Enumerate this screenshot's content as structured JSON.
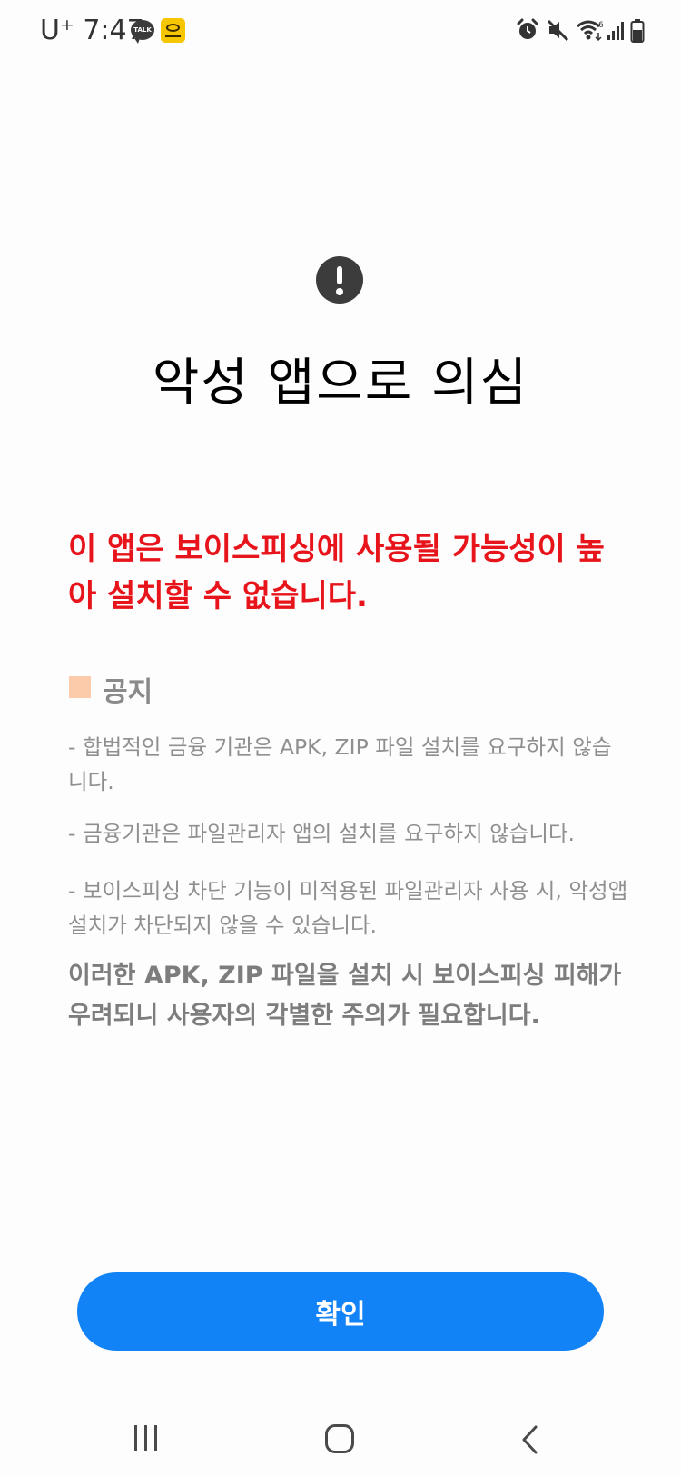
{
  "status_bar": {
    "carrier_time": "U⁺ 7:47",
    "talk_badge": "TALK",
    "icons": [
      "kakaotalk-icon",
      "bank-app-icon",
      "alarm-icon",
      "mute-icon",
      "wifi-icon",
      "signal-icon",
      "battery-icon"
    ]
  },
  "dialog": {
    "icon": "alert-icon",
    "title": "악성 앱으로 의심",
    "warning": "이 앱은 보이스피싱에 사용될 가능성이 높아 설치할 수 없습니다.",
    "notice_heading": "공지",
    "notices": [
      "- 합법적인 금융 기관은 APK, ZIP 파일 설치를 요구하지 않습니다.",
      "- 금융기관은 파일관리자 앱의 설치를 요구하지 않습니다.",
      "- 보이스피싱 차단 기능이 미적용된 파일관리자 사용 시, 악성앱 설치가 차단되지 않을 수 있습니다."
    ],
    "caution": "이러한 APK, ZIP 파일을 설치 시 보이스피싱 피해가 우려되니 사용자의 각별한 주의가 필요합니다.",
    "confirm_label": "확인"
  },
  "navigation": {
    "items": [
      "recents-icon",
      "home-icon",
      "back-icon"
    ]
  },
  "colors": {
    "warning": "#e8141b",
    "accent": "#1183f6",
    "notice_square": "#fcccaa"
  }
}
